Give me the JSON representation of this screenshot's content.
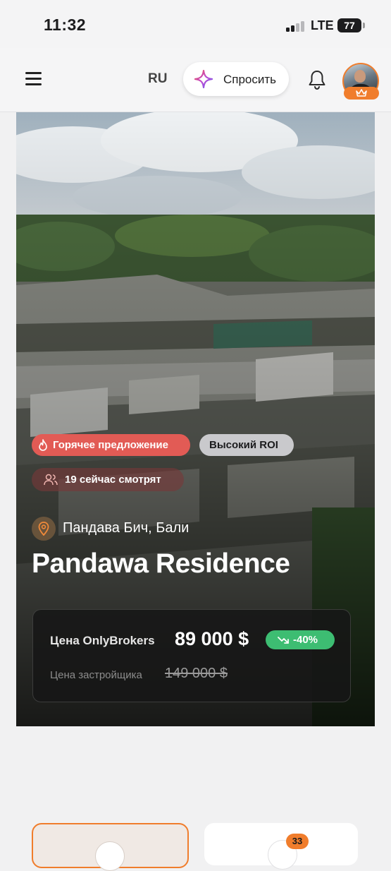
{
  "status_bar": {
    "time": "11:32",
    "network": "LTE",
    "battery": "77"
  },
  "header": {
    "language": "RU",
    "ask_label": "Спросить"
  },
  "listing": {
    "badges": {
      "hot": "Горячее предложение",
      "roi": "Высокий ROI",
      "viewers": "19 сейчас смотрят"
    },
    "location": "Пандава Бич, Бали",
    "title": "Pandawa Residence",
    "price_label": "Цена OnlyBrokers",
    "price": "89 000 $",
    "discount": "-40%",
    "developer_price_label": "Цена застройщика",
    "developer_price": "149 000 $"
  },
  "bottom_cards": {
    "count_badge": "33"
  },
  "colors": {
    "accent": "#f07d2c",
    "hot_badge": "#e25b55",
    "discount_badge": "#3dbd72"
  }
}
